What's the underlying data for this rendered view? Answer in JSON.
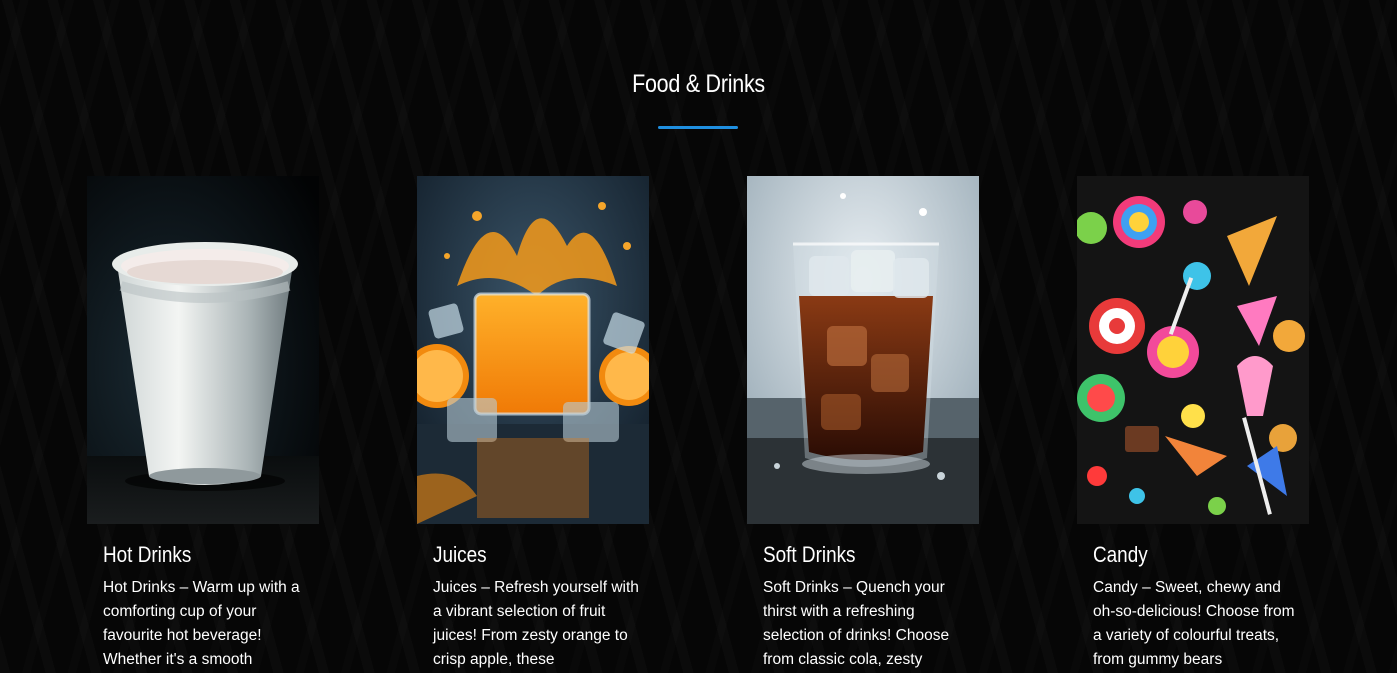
{
  "section": {
    "title": "Food & Drinks",
    "accent_color": "#1f8fe0"
  },
  "cards": [
    {
      "title": "Hot Drinks",
      "text": "Hot Drinks – Warm up with a comforting cup of your favourite hot beverage! Whether it's a smooth",
      "image": "white-paper-cup-photo"
    },
    {
      "title": "Juices",
      "text": "Juices – Refresh yourself with a vibrant selection of fruit juices! From zesty orange to crisp apple, these",
      "image": "orange-juice-splash-photo"
    },
    {
      "title": "Soft Drinks",
      "text": "Soft Drinks – Quench your thirst with a refreshing selection of drinks! Choose from classic cola, zesty",
      "image": "cola-glass-with-ice-photo"
    },
    {
      "title": "Candy",
      "text": "Candy – Sweet, chewy and oh-so-delicious! Choose from a variety of colourful treats, from gummy bears",
      "image": "colourful-candy-photo"
    }
  ]
}
